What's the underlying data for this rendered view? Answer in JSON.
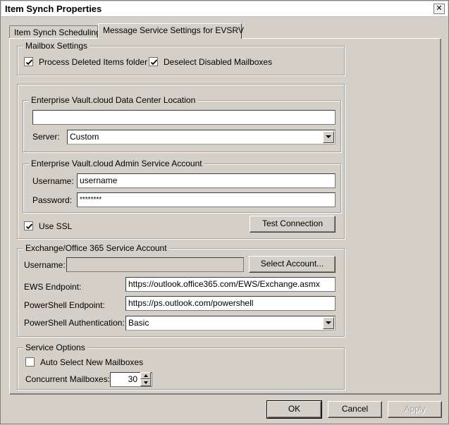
{
  "window": {
    "title": "Item Synch Properties",
    "close_glyph": "✕"
  },
  "tabs": [
    {
      "label": "Item Synch Scheduling",
      "active": false
    },
    {
      "label": "Message Service Settings for EVSRV",
      "active": true
    }
  ],
  "mailbox_settings": {
    "legend": "Mailbox Settings",
    "process_deleted": {
      "label": "Process Deleted Items folder",
      "checked": true
    },
    "deselect_disabled": {
      "label": "Deselect Disabled Mailboxes",
      "checked": true
    }
  },
  "dc_location": {
    "legend": "Enterprise Vault.cloud Data Center Location",
    "url_value": "",
    "server_label": "Server:",
    "server_value": "Custom"
  },
  "admin_account": {
    "legend": "Enterprise Vault.cloud Admin Service Account",
    "username_label": "Username:",
    "username_value": "username",
    "password_label": "Password:",
    "password_value": "********"
  },
  "use_ssl": {
    "label": "Use SSL",
    "checked": true
  },
  "test_connection_label": "Test Connection",
  "exchange_account": {
    "legend": "Exchange/Office 365 Service Account",
    "username_label": "Username:",
    "username_value": "",
    "select_account_label": "Select Account...",
    "ews_label": "EWS Endpoint:",
    "ews_value": "https://outlook.office365.com/EWS/Exchange.asmx",
    "ps_label": "PowerShell Endpoint:",
    "ps_value": "https://ps.outlook.com/powershell",
    "auth_label": "PowerShell Authentication:",
    "auth_value": "Basic"
  },
  "service_options": {
    "legend": "Service Options",
    "auto_select": {
      "label": "Auto Select New Mailboxes",
      "checked": false
    },
    "concurrent_label": "Concurrent Mailboxes:",
    "concurrent_value": "30"
  },
  "footer": {
    "ok_label": "OK",
    "cancel_label": "Cancel",
    "apply_label": "Apply"
  }
}
